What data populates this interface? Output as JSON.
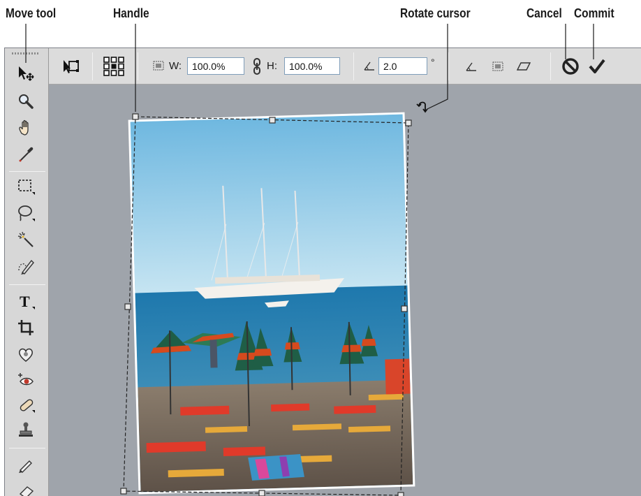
{
  "callouts": {
    "move_tool": "Move tool",
    "handle": "Handle",
    "rotate_cursor": "Rotate cursor",
    "cancel": "Cancel",
    "commit": "Commit"
  },
  "options_bar": {
    "width_label": "W:",
    "width_value": "100.0%",
    "height_label": "H:",
    "height_value": "100.0%",
    "angle_value": "2.0",
    "degree_symbol": "°"
  },
  "tools": [
    "move-icon",
    "zoom-icon",
    "hand-icon",
    "eyedropper-icon",
    "marquee-icon",
    "lasso-icon",
    "magic-wand-icon",
    "quick-selection-icon",
    "type-icon",
    "crop-icon",
    "shape-heart-icon",
    "red-eye-icon",
    "healing-brush-icon",
    "clone-stamp-icon",
    "pencil-icon"
  ],
  "colors": {
    "canvas": "#9fa4ab",
    "panel": "#d7d7d7",
    "field_border": "#7f9db9",
    "cancel": "#222222",
    "commit": "#222222"
  }
}
